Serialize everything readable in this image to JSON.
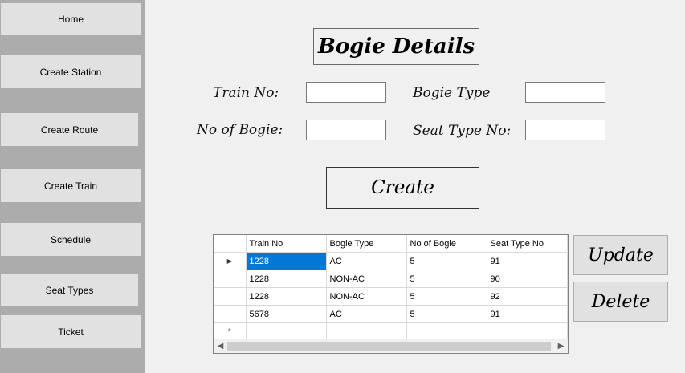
{
  "sidebar": {
    "items": [
      {
        "label": "Home"
      },
      {
        "label": "Create Station"
      },
      {
        "label": "Create Route"
      },
      {
        "label": "Create Train"
      },
      {
        "label": "Schedule"
      },
      {
        "label": "Seat Types"
      },
      {
        "label": "Ticket"
      }
    ]
  },
  "form": {
    "title": "Bogie Details",
    "train_no_label": "Train No:",
    "bogie_type_label": "Bogie Type",
    "no_of_bogie_label": "No of Bogie:",
    "seat_type_no_label": "Seat Type No:",
    "train_no_value": "",
    "bogie_type_value": "",
    "no_of_bogie_value": "",
    "seat_type_no_value": "",
    "create_label": "Create"
  },
  "grid": {
    "columns": [
      "Train No",
      "Bogie Type",
      "No of Bogie",
      "Seat Type No"
    ],
    "rows": [
      [
        "1228",
        "AC",
        "5",
        "91"
      ],
      [
        "1228",
        "NON-AC",
        "5",
        "90"
      ],
      [
        "1228",
        "NON-AC",
        "5",
        "92"
      ],
      [
        "5678",
        "AC",
        "5",
        "91"
      ]
    ],
    "current_row_marker": "▶",
    "new_row_marker": "*"
  },
  "actions": {
    "update_label": "Update",
    "delete_label": "Delete"
  },
  "colors": {
    "sidebar_bg": "#acacac",
    "selection": "#0078d7"
  }
}
